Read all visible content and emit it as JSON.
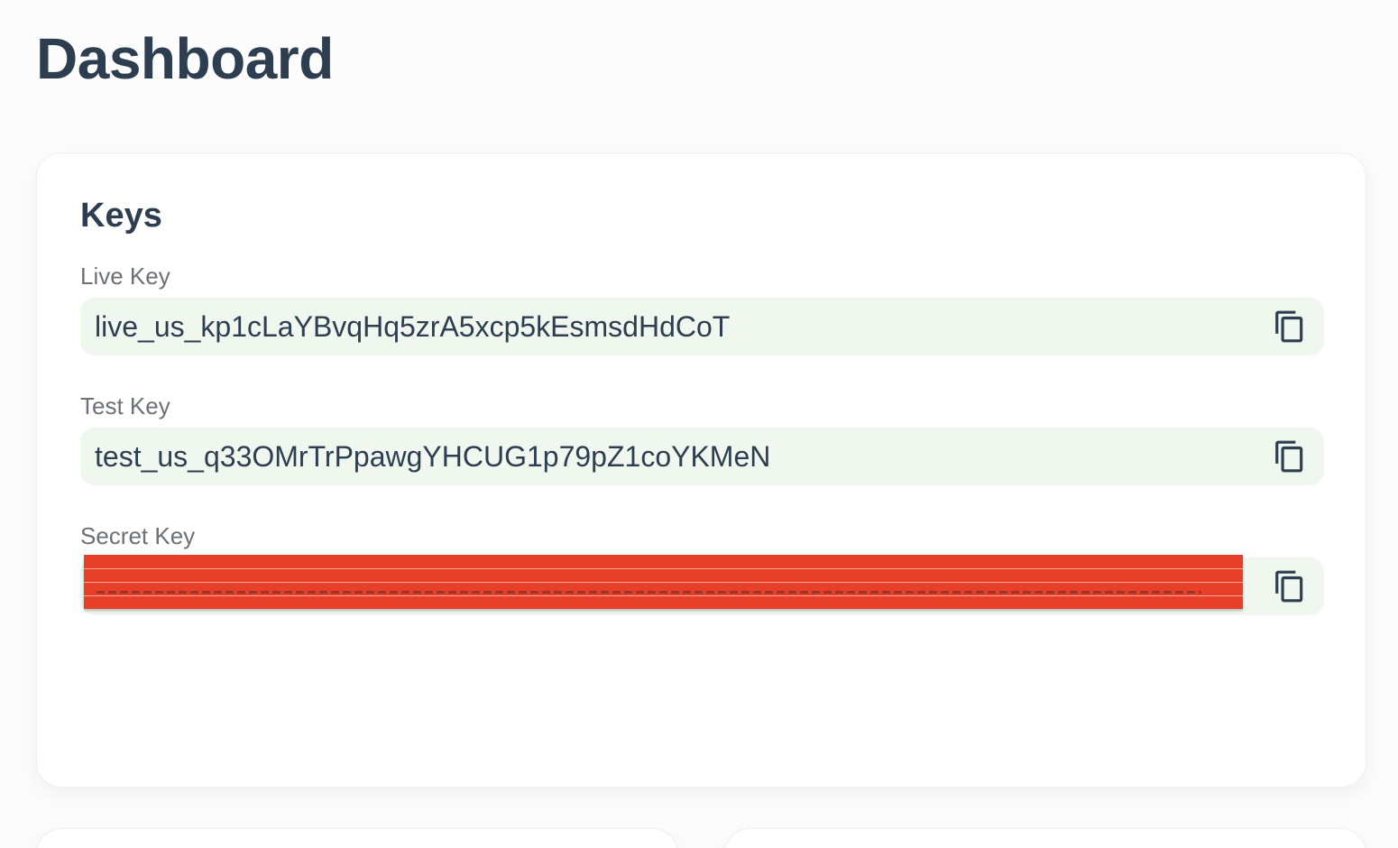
{
  "page": {
    "title": "Dashboard"
  },
  "keys_card": {
    "title": "Keys",
    "live": {
      "label": "Live Key",
      "value": "live_us_kp1cLaYBvqHq5zrA5xcp5kEsmsdHdCoT",
      "copy_icon": "copy-icon"
    },
    "test": {
      "label": "Test Key",
      "value": "test_us_q33OMrTrPpawgYHCUG1p79pZ1coYKMeN",
      "copy_icon": "copy-icon"
    },
    "secret": {
      "label": "Secret Key",
      "redacted": true,
      "copy_icon": "copy-icon"
    }
  },
  "colors": {
    "text_primary": "#2c3e50",
    "label_text": "#6b7177",
    "key_background": "#f0f7ee",
    "redaction": "#e83f29"
  }
}
